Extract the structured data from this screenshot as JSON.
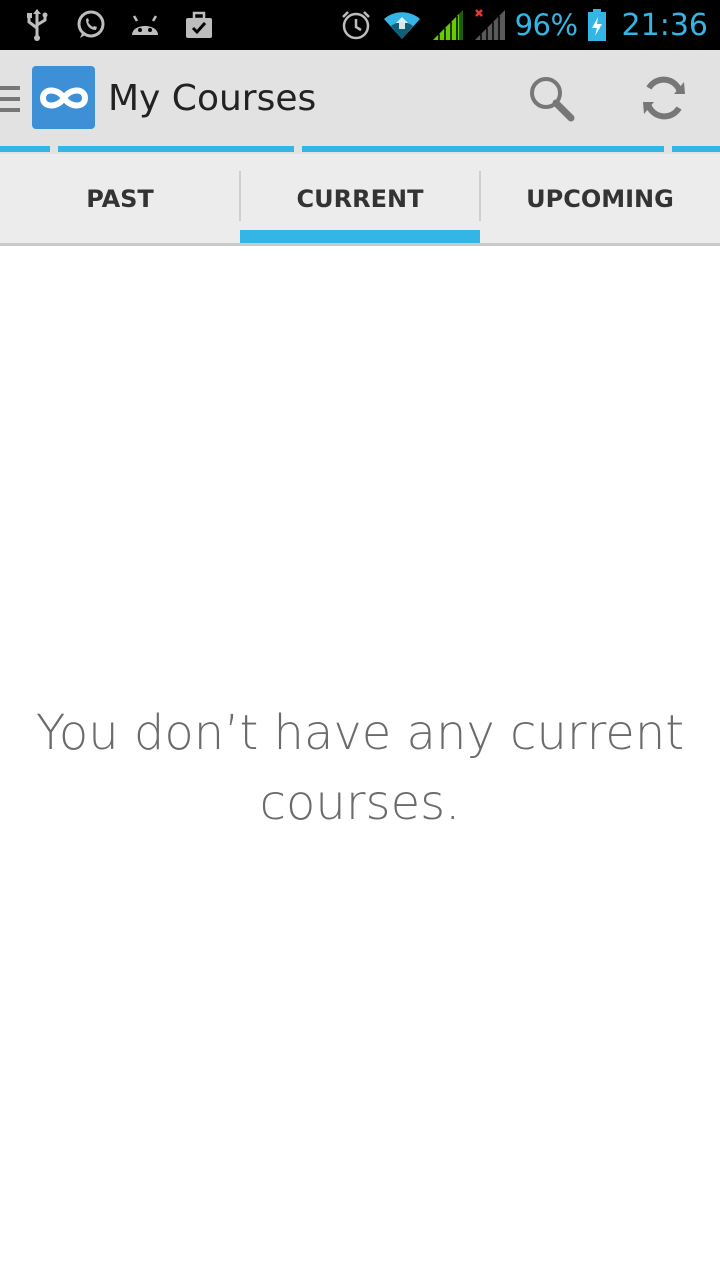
{
  "status_bar": {
    "left_icons": [
      "usb-icon",
      "whatsapp-icon",
      "android-icon",
      "briefcase-icon"
    ],
    "right_icons": [
      "alarm-icon",
      "wifi-icon",
      "signal-icon",
      "signal-nodata-icon",
      "battery-charging-icon"
    ],
    "battery_percent": "96%",
    "time": "21:36",
    "accent_color": "#33b5e5"
  },
  "action_bar": {
    "title": "My Courses",
    "logo_icon": "infinity-logo-icon",
    "actions": [
      "search-icon",
      "refresh-icon"
    ]
  },
  "tabs": {
    "items": [
      {
        "label": "PAST"
      },
      {
        "label": "CURRENT"
      },
      {
        "label": "UPCOMING"
      }
    ],
    "selected": "CURRENT",
    "indicator_color": "#33b5e5"
  },
  "main": {
    "empty_message": "You don’t have any current courses."
  }
}
